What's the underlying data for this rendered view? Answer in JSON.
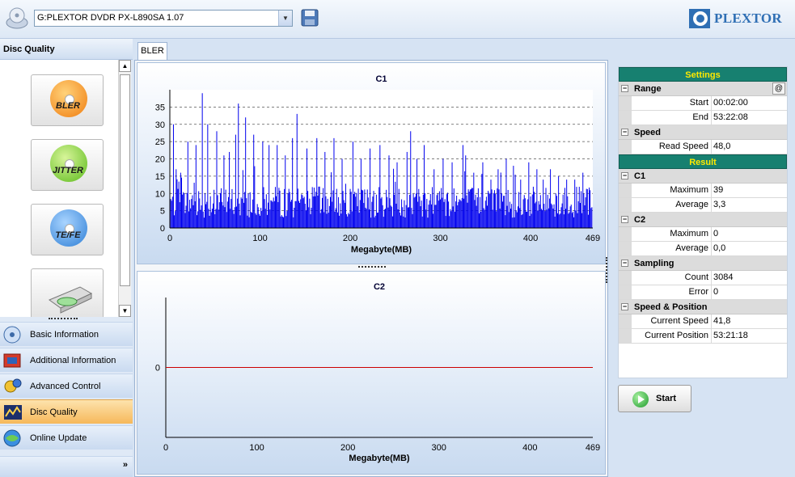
{
  "toolbar": {
    "drive": "G:PLEXTOR DVDR   PX-L890SA 1.07",
    "brand": "PLEXTOR"
  },
  "left_panel": {
    "title": "Disc Quality",
    "tests": [
      {
        "label": "BLER",
        "icon": "bler-disc-icon",
        "color": "#f07d10"
      },
      {
        "label": "JITTER",
        "icon": "jitter-disc-icon",
        "color": "#5dbb1c"
      },
      {
        "label": "TE/FE",
        "icon": "tefe-disc-icon",
        "color": "#2f7fd6"
      },
      {
        "label": "",
        "icon": "optical-drive-icon",
        "color": "#888888"
      }
    ],
    "nav": [
      {
        "label": "Basic Information",
        "icon": "basic-info-icon",
        "selected": false
      },
      {
        "label": "Additional Information",
        "icon": "additional-info-icon",
        "selected": false
      },
      {
        "label": "Advanced Control",
        "icon": "advanced-control-icon",
        "selected": false
      },
      {
        "label": "Disc Quality",
        "icon": "disc-quality-icon",
        "selected": true
      },
      {
        "label": "Online Update",
        "icon": "online-update-icon",
        "selected": false
      }
    ]
  },
  "tabs": {
    "active": "BLER"
  },
  "chart_data": [
    {
      "type": "bar",
      "title": "C1",
      "xlabel": "Megabyte(MB)",
      "ylabel": "",
      "xlim": [
        0,
        469
      ],
      "ylim": [
        0,
        40
      ],
      "xticks": [
        0,
        100,
        200,
        300,
        400,
        469
      ],
      "yticks": [
        0,
        5,
        10,
        15,
        20,
        25,
        30,
        35
      ],
      "grid": "horizontal dashed",
      "color": "#0000ee",
      "series": [
        {
          "peaks": [
            [
              4,
              30
            ],
            [
              7,
              17
            ],
            [
              12,
              16
            ],
            [
              20,
              25
            ],
            [
              29,
              24
            ],
            [
              36,
              39
            ],
            [
              42,
              30
            ],
            [
              52,
              28
            ],
            [
              60,
              21
            ],
            [
              66,
              22
            ],
            [
              73,
              27
            ],
            [
              76,
              36
            ],
            [
              84,
              32
            ],
            [
              93,
              27
            ],
            [
              103,
              25
            ],
            [
              110,
              24
            ],
            [
              119,
              24
            ],
            [
              128,
              21
            ],
            [
              136,
              26
            ],
            [
              141,
              33
            ],
            [
              152,
              23
            ],
            [
              163,
              26
            ],
            [
              172,
              22
            ],
            [
              182,
              26
            ],
            [
              191,
              20
            ],
            [
              203,
              25
            ],
            [
              212,
              20
            ],
            [
              222,
              23
            ],
            [
              233,
              24
            ],
            [
              243,
              21
            ],
            [
              252,
              19
            ],
            [
              263,
              22
            ],
            [
              267,
              28
            ],
            [
              274,
              20
            ],
            [
              282,
              24
            ],
            [
              293,
              17
            ],
            [
              303,
              20
            ],
            [
              313,
              19
            ],
            [
              325,
              24
            ],
            [
              328,
              21
            ],
            [
              337,
              16
            ],
            [
              347,
              19
            ],
            [
              356,
              14
            ],
            [
              364,
              17
            ],
            [
              373,
              20
            ],
            [
              381,
              18
            ],
            [
              389,
              14
            ],
            [
              398,
              19
            ],
            [
              407,
              17
            ],
            [
              414,
              14
            ],
            [
              422,
              17
            ],
            [
              431,
              15
            ],
            [
              440,
              14
            ],
            [
              449,
              14
            ],
            [
              458,
              16
            ]
          ]
        }
      ]
    },
    {
      "type": "line",
      "title": "C2",
      "xlabel": "Megabyte(MB)",
      "ylabel": "",
      "xlim": [
        0,
        469
      ],
      "xticks": [
        0,
        100,
        200,
        300,
        400,
        469
      ],
      "yticks": [
        0
      ],
      "color": "#cc0000",
      "series": [
        {
          "x": [
            0,
            469
          ],
          "y": [
            0,
            0
          ]
        }
      ]
    }
  ],
  "settings": {
    "header": "Settings",
    "range_label": "Range",
    "at_button": "@",
    "start_label": "Start",
    "start_value": "00:02:00",
    "end_label": "End",
    "end_value": "53:22:08",
    "speed_label": "Speed",
    "read_speed_label": "Read Speed",
    "read_speed_value": "48,0"
  },
  "result": {
    "header": "Result",
    "c1_label": "C1",
    "c1_max_label": "Maximum",
    "c1_max": "39",
    "c1_avg_label": "Average",
    "c1_avg": "3,3",
    "c2_label": "C2",
    "c2_max_label": "Maximum",
    "c2_max": "0",
    "c2_avg_label": "Average",
    "c2_avg": "0,0",
    "sampling_label": "Sampling",
    "count_label": "Count",
    "count": "3084",
    "error_label": "Error",
    "error": "0",
    "sp_label": "Speed & Position",
    "cur_speed_label": "Current Speed",
    "cur_speed": "41,8",
    "cur_pos_label": "Current Position",
    "cur_pos": "53:21:18"
  },
  "actions": {
    "start": "Start"
  }
}
